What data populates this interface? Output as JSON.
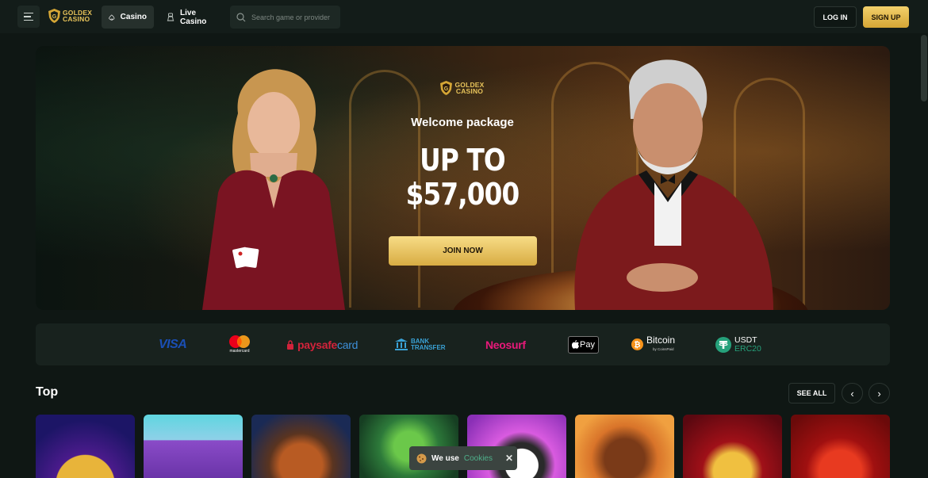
{
  "header": {
    "logo_line1": "GOLDEX",
    "logo_line2": "CASINO",
    "tabs": [
      {
        "label": "Casino",
        "icon": "spade-icon",
        "active": true
      },
      {
        "label": "Live Casino",
        "icon": "dealer-icon",
        "active": false
      }
    ],
    "search_placeholder": "Search game or provider",
    "login_label": "LOG IN",
    "signup_label": "SIGN UP"
  },
  "hero": {
    "logo_line1": "GOLDEX",
    "logo_line2": "CASINO",
    "subtitle": "Welcome package",
    "amount_line1": "UP TO",
    "amount_line2": "$57,000",
    "cta_label": "JOIN NOW"
  },
  "payments": {
    "visa": "VISA",
    "mastercard": "mastercard",
    "paysafe_1": "paysafe",
    "paysafe_2": "card",
    "bank_1": "BANK",
    "bank_2": "TRANSFER",
    "neosurf": "Neosurf",
    "applepay": "Pay",
    "bitcoin": "Bitcoin",
    "bitcoin_sub": "by CoinsPaid",
    "usdt_1": "USDT",
    "usdt_2": "ERC20"
  },
  "top_section": {
    "title": "Top",
    "see_all_label": "SEE ALL",
    "prev": "‹",
    "next": "›"
  },
  "cookie": {
    "prefix": "We use",
    "link": "Cookies",
    "close": "✕"
  },
  "colors": {
    "background": "#0f1714",
    "gold": "#e7c35a",
    "accent_green": "#4fb08a"
  }
}
